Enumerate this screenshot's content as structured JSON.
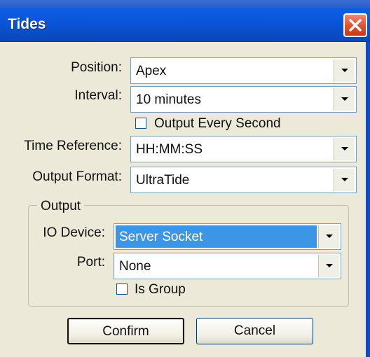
{
  "window": {
    "title": "Tides"
  },
  "icons": {
    "close": "close-x-icon",
    "dropdown": "chevron-down-icon"
  },
  "colors": {
    "titlebar": "#0b54d8",
    "selection": "#3d95e6",
    "close": "#e0502f"
  },
  "form": {
    "position_label": "Position:",
    "position_value": "Apex",
    "interval_label": "Interval:",
    "interval_value": "10 minutes",
    "output_every_second_label": "Output Every Second",
    "output_every_second_checked": false,
    "time_reference_label": "Time Reference:",
    "time_reference_value": "HH:MM:SS",
    "output_format_label": "Output Format:",
    "output_format_value": "UltraTide"
  },
  "output_group": {
    "legend": "Output",
    "io_device_label": "IO Device:",
    "io_device_value": "Server Socket",
    "port_label": "Port:",
    "port_value": "None",
    "is_group_label": "Is Group",
    "is_group_checked": false
  },
  "buttons": {
    "confirm": "Confirm",
    "cancel": "Cancel"
  }
}
